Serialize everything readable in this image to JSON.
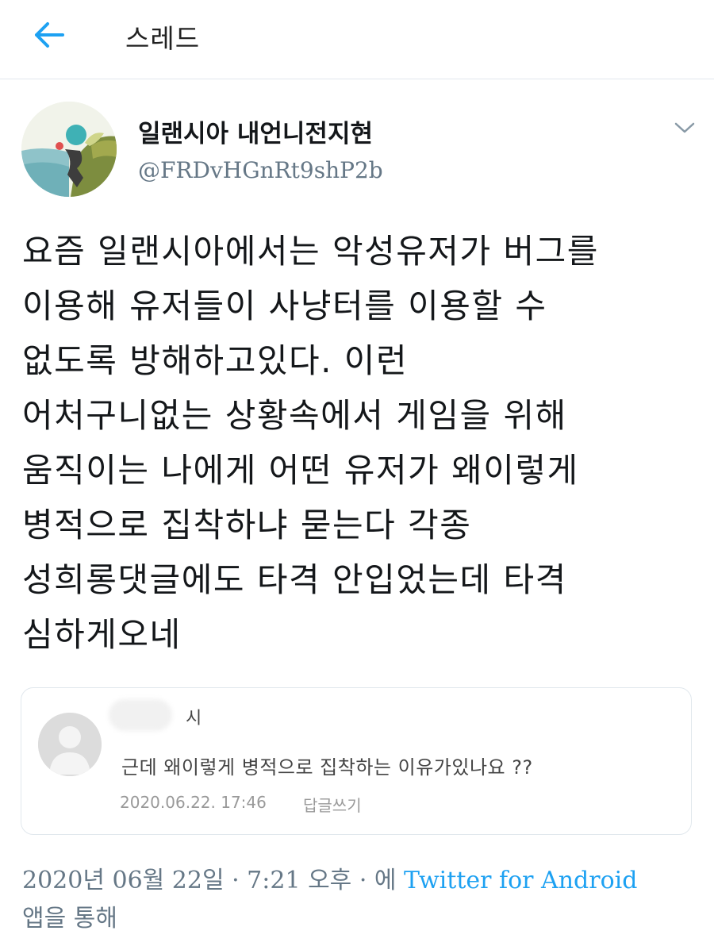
{
  "header": {
    "title": "스레드",
    "back_icon": "arrow-left-icon",
    "accent_color": "#1da1f2"
  },
  "tweet": {
    "display_name": "일랜시아 내언니전지현",
    "handle": "@FRDvHGnRt9shP2b",
    "menu_icon": "chevron-down-icon",
    "text_lines": [
      "요즘 일랜시아에서는 악성유저가 버그를",
      "이용해 유저들이 사냥터를 이용할 수",
      "없도록 방해하고있다. 이런",
      "어처구니없는 상황속에서 게임을 위해",
      "움직이는 나에게 어떤 유저가 왜이렇게",
      "병적으로 집착하냐 묻는다 각종",
      "성희롱댓글에도 타격 안입었는데 타격",
      "심하게오네"
    ],
    "timestamp": "2020년 06월 22일 · 7:21 오후 · 에",
    "source": "Twitter for Android",
    "via": "앱을 통해"
  },
  "media": {
    "comment": {
      "author_suffix": "시",
      "text": "근데 왜이렇게 병적으로 집착하는 이유가있나요 ??",
      "date": "2020.06.22. 17:46",
      "reply_label": "답글쓰기"
    }
  }
}
